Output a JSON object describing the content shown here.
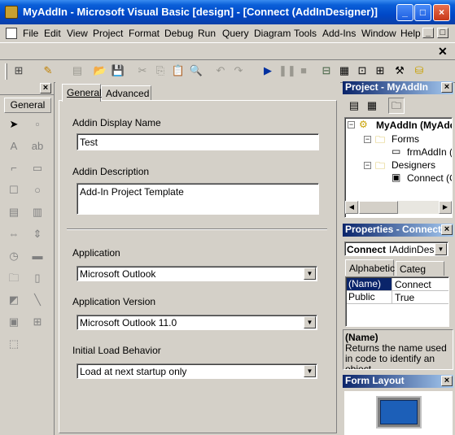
{
  "window": {
    "title": "MyAddIn - Microsoft Visual Basic [design] - [Connect (AddInDesigner)]"
  },
  "menu": [
    "File",
    "Edit",
    "View",
    "Project",
    "Format",
    "Debug",
    "Run",
    "Query",
    "Diagram",
    "Tools",
    "Add-Ins",
    "Window",
    "Help"
  ],
  "toolbox": {
    "tab": "General"
  },
  "designer": {
    "tabs": [
      "General",
      "Advanced"
    ],
    "display_name_label": "Addin Display Name",
    "display_name_value": "Test",
    "description_label": "Addin Description",
    "description_value": "Add-In Project Template",
    "application_label": "Application",
    "application_value": "Microsoft Outlook",
    "version_label": "Application Version",
    "version_value": "Microsoft Outlook 11.0",
    "load_label": "Initial Load Behavior",
    "load_value": "Load at next startup only"
  },
  "project": {
    "title": "Project - MyAddIn",
    "root": "MyAddIn (MyAdd",
    "forms": "Forms",
    "form_item": "frmAddIn (",
    "designers": "Designers",
    "designer_item": "Connect (C"
  },
  "properties": {
    "title": "Properties - Connect",
    "object_name": "Connect",
    "object_type": "IAddinDesig",
    "tabs": [
      "Alphabetic",
      "Categ"
    ],
    "rows": [
      {
        "name": "(Name)",
        "value": "Connect"
      },
      {
        "name": "Public",
        "value": "True"
      }
    ],
    "desc_title": "(Name)",
    "desc_text": "Returns the name used in code to identify an object."
  },
  "form_layout": {
    "title": "Form Layout"
  }
}
